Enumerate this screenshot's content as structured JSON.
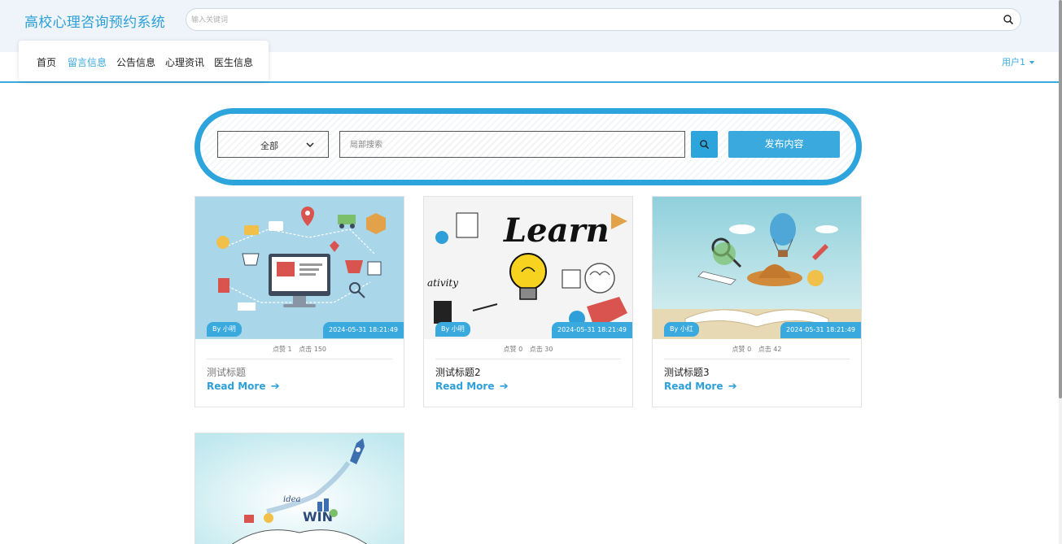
{
  "header": {
    "site_title": "高校心理咨询预约系统",
    "search_placeholder": "输入关键词"
  },
  "nav": {
    "items": [
      "首页",
      "留言信息",
      "公告信息",
      "心理资讯",
      "医生信息"
    ],
    "active": "留言信息",
    "user_label": "用户1"
  },
  "filter": {
    "category_selected": "全部",
    "search_placeholder": "局部搜索",
    "publish_label": "发布内容"
  },
  "colors": {
    "accent": "#3aa9dd",
    "header_bg": "#eef4fa"
  },
  "cards": [
    {
      "title": "测试标题",
      "author": "By 小明",
      "time": "2024-05-31 18:21:49",
      "likes_label": "点赞 1",
      "clicks_label": "点击 150",
      "read_more": "Read More",
      "image_subject": "ecommerce-illustration"
    },
    {
      "title": "测试标题2",
      "author": "By 小明",
      "time": "2024-05-31 18:21:49",
      "likes_label": "点赞 0",
      "clicks_label": "点击 30",
      "read_more": "Read More",
      "image_subject": "learn-lightbulb-illustration"
    },
    {
      "title": "测试标题3",
      "author": "By 小红",
      "time": "2024-05-31 18:21:49",
      "likes_label": "点赞 0",
      "clicks_label": "点击 42",
      "read_more": "Read More",
      "image_subject": "open-book-travel-illustration"
    },
    {
      "image_subject": "rocket-book-win-illustration",
      "image_text": "WIN"
    }
  ]
}
